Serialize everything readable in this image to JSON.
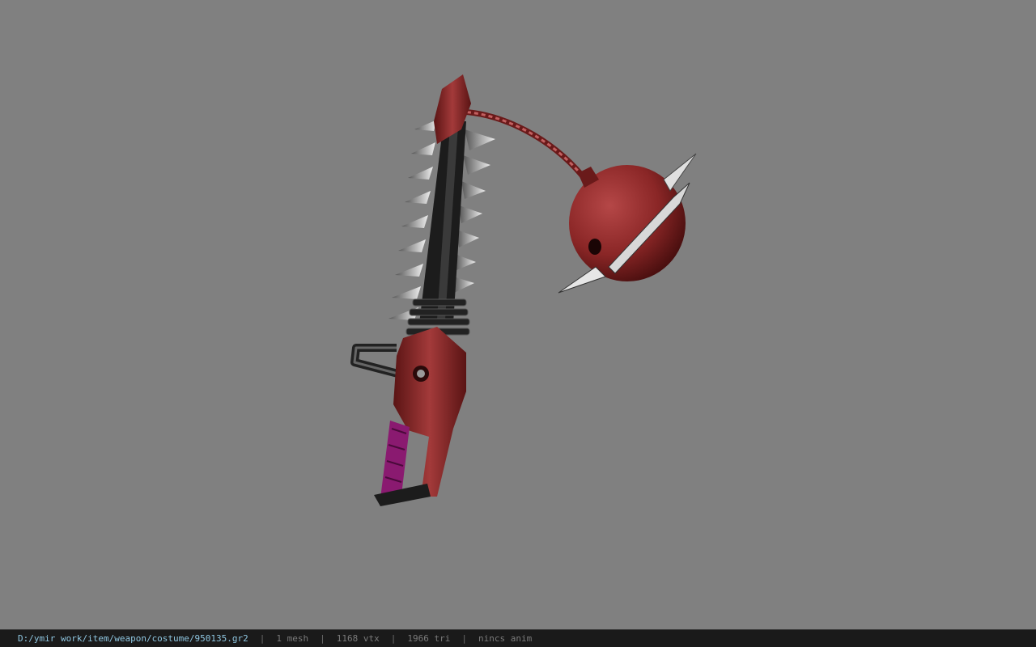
{
  "viewport": {
    "background": "#808080",
    "model_colors": {
      "red": "#8e2a2a",
      "dark_red": "#5a1414",
      "black": "#1c1c1c",
      "grip": "#8a1a70",
      "metal": "#cfcfcf"
    }
  },
  "status": {
    "path": "D:/ymir work/item/weapon/costume/950135.gr2",
    "separator": "|",
    "mesh": "1 mesh",
    "vertices": "1168 vtx",
    "triangles": "1966 tri",
    "anim": "nincs anim"
  }
}
